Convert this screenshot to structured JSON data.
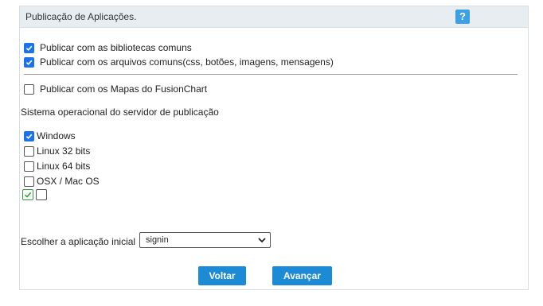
{
  "header": {
    "title": "Publicação de Aplicações.",
    "help_label": "?"
  },
  "options": [
    {
      "label": "Publicar com as bibliotecas comuns",
      "checked": true
    },
    {
      "label": "Publicar com os arquivos comuns(css, botões, imagens, mensagens)",
      "checked": true
    },
    {
      "label": "Publicar com os Mapas do FusionChart",
      "checked": false
    }
  ],
  "os_section": {
    "title": "Sistema operacional do servidor de publicação",
    "items": [
      {
        "label": "Windows",
        "checked": true
      },
      {
        "label": "Linux 32 bits",
        "checked": false
      },
      {
        "label": "Linux 64 bits",
        "checked": false
      },
      {
        "label": "OSX / Mac OS",
        "checked": false
      }
    ]
  },
  "initial_app": {
    "label": "Escolher a aplicação inicial",
    "selected": "signin"
  },
  "buttons": {
    "back": "Voltar",
    "next": "Avançar"
  },
  "colors": {
    "accent": "#1d8ad6",
    "help": "#3ea0e4",
    "header_bg": "#e8edf2"
  }
}
